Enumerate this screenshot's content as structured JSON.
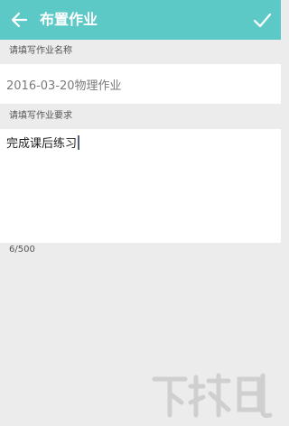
{
  "toolbar": {
    "title": "布置作业",
    "back_icon": "back-arrow-icon",
    "confirm_icon": "checkmark-icon",
    "background": "#5cc9c6"
  },
  "form": {
    "name_label": "请填写作业名称",
    "name_value": "2016-03-20物理作业",
    "requirement_label": "请填写作业要求",
    "requirement_value": "完成课后练习",
    "counter": "6/500"
  },
  "watermark": {
    "text": "下载吧"
  }
}
